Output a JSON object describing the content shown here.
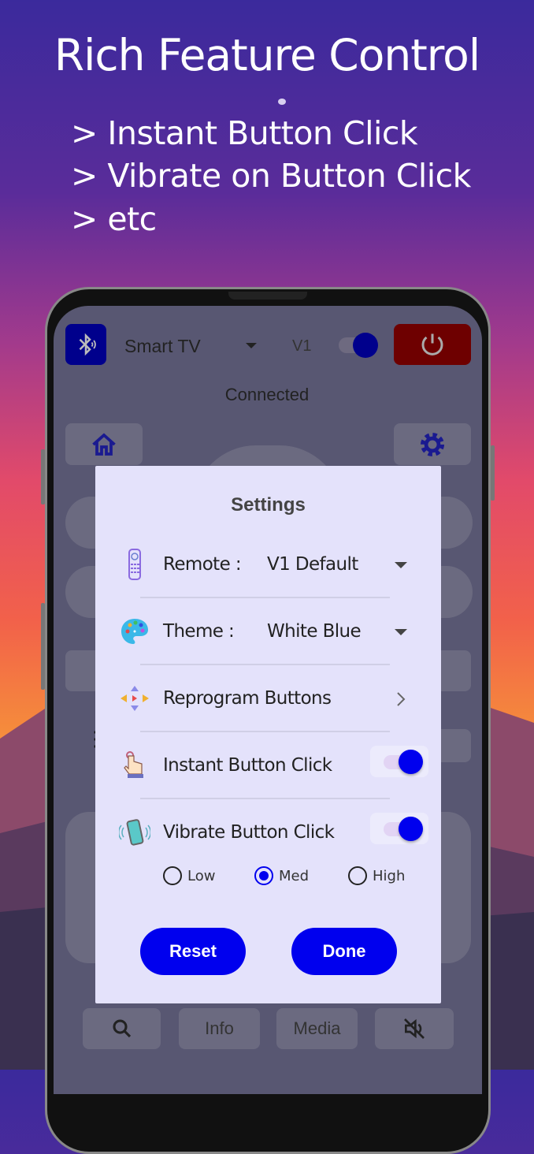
{
  "promo": {
    "headline": "Rich Feature Control",
    "bullets": [
      "> Instant Button Click",
      "> Vibrate on Button Click",
      "> etc"
    ]
  },
  "header": {
    "device": "Smart TV",
    "version": "V1",
    "status": "Connected"
  },
  "bottom_bar": {
    "info": "Info",
    "media": "Media"
  },
  "settings": {
    "title": "Settings",
    "remote": {
      "label": "Remote :",
      "value": "V1 Default"
    },
    "theme": {
      "label": "Theme :",
      "value": "White Blue"
    },
    "reprogram": {
      "label": "Reprogram Buttons"
    },
    "instant": {
      "label": "Instant Button Click",
      "enabled": true
    },
    "vibrate": {
      "label": "Vibrate Button Click",
      "enabled": true
    },
    "intensity": {
      "options": [
        "Low",
        "Med",
        "High"
      ],
      "selected": "Med"
    },
    "reset": "Reset",
    "done": "Done"
  },
  "colors": {
    "accent": "#0000ee",
    "dialog_bg": "#e4e2fb",
    "power": "#6e0000"
  }
}
